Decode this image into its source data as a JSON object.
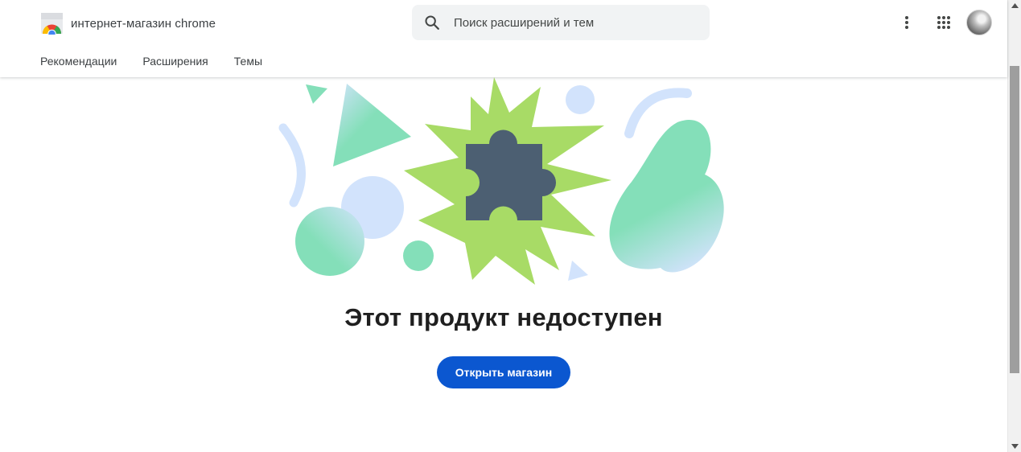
{
  "header": {
    "brand_title": "интернет-магазин chrome",
    "search": {
      "placeholder": "Поиск расширений и тем",
      "value": ""
    },
    "icons": [
      "more-vert-icon",
      "apps-grid-icon",
      "account-avatar"
    ]
  },
  "nav": {
    "items": [
      {
        "label": "Рекомендации"
      },
      {
        "label": "Расширения"
      },
      {
        "label": "Темы"
      }
    ]
  },
  "main": {
    "illustration": "puzzle-starburst-illustration",
    "title": "Этот продукт недоступен",
    "open_store_label": "Открыть магазин"
  },
  "colors": {
    "accent_button": "#0b57d0",
    "starburst_green": "#a8db66",
    "puzzle_slate": "#4c5f72",
    "mint": "#84dfb9",
    "light_blue": "#d2e3fc"
  }
}
